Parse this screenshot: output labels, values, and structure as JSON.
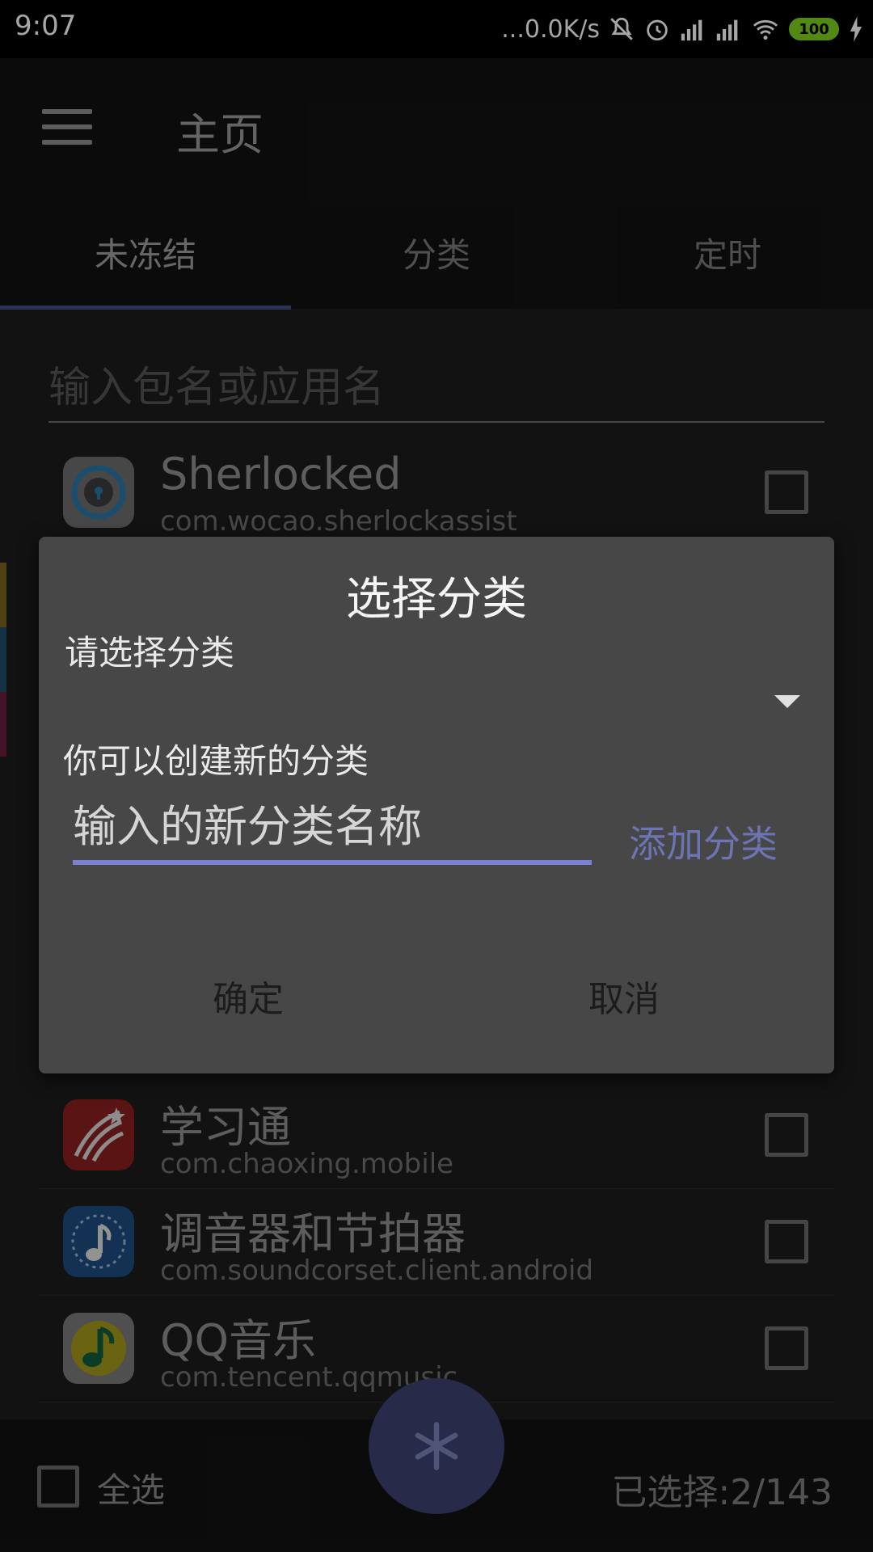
{
  "status_bar": {
    "time": "9:07",
    "net_speed": "...0.0K/s",
    "battery": "100"
  },
  "app_bar": {
    "title": "主页"
  },
  "tabs": [
    {
      "label": "未冻结",
      "active": true
    },
    {
      "label": "分类",
      "active": false
    },
    {
      "label": "定时",
      "active": false
    }
  ],
  "search": {
    "placeholder": "输入包名或应用名"
  },
  "apps": [
    {
      "name": "Sherlocked",
      "package": "com.wocao.sherlockassist",
      "icon": "sherlocked-icon"
    },
    {
      "name": "学习通",
      "package": "com.chaoxing.mobile",
      "icon": "xuexitong-icon"
    },
    {
      "name": "调音器和节拍器",
      "package": "com.soundcorset.client.android",
      "icon": "tuner-icon"
    },
    {
      "name": "QQ音乐",
      "package": "com.tencent.qqmusic",
      "icon": "qqmusic-icon"
    }
  ],
  "bottom_bar": {
    "select_all_label": "全选",
    "selected_count": "已选择:2/143",
    "fab_icon": "snowflake-icon"
  },
  "dialog": {
    "title": "选择分类",
    "select_label": "请选择分类",
    "create_label": "你可以创建新的分类",
    "new_category_placeholder": "输入的新分类名称",
    "add_button": "添加分类",
    "ok_button": "确定",
    "cancel_button": "取消"
  },
  "colors": {
    "accent": "#7a82cf",
    "fab": "#3d4270",
    "dialog_bg": "#474747"
  }
}
